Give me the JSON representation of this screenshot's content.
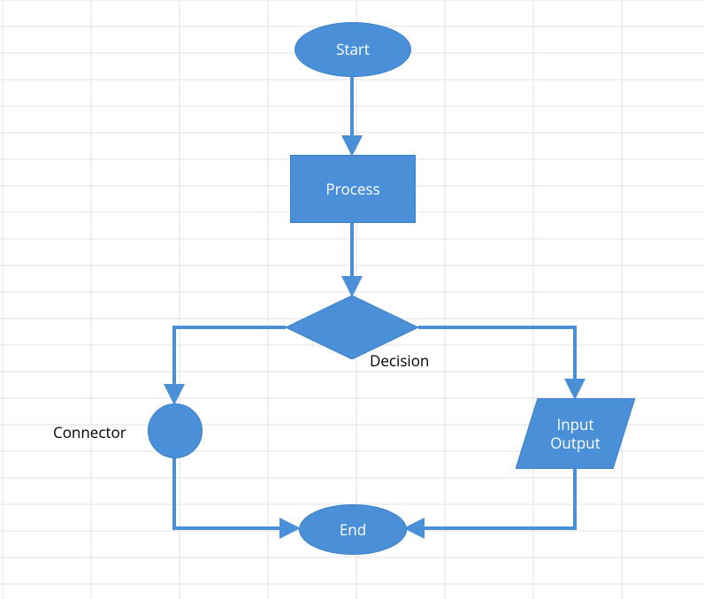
{
  "nodes": {
    "start": {
      "label": "Start"
    },
    "process": {
      "label": "Process"
    },
    "decision": {
      "label": "Decision"
    },
    "connector": {
      "label": "Connector"
    },
    "io": {
      "label": "Input\nOutput"
    },
    "end": {
      "label": "End"
    }
  },
  "colors": {
    "shape_fill": "#4a90d9",
    "shape_stroke": "#3a7fc8",
    "connector_line": "#4a90d9",
    "grid": "#e0e0e0"
  }
}
